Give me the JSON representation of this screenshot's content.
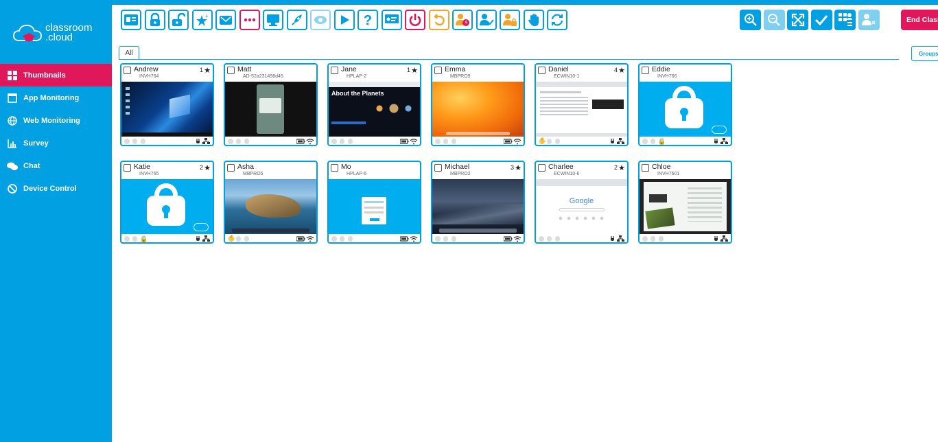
{
  "app": {
    "brand_line1": "classroom",
    "brand_line2": ".cloud"
  },
  "colors": {
    "primary": "#00a0e3",
    "accent": "#e0185b",
    "warn": "#f2a52e"
  },
  "sidebar": {
    "items": [
      {
        "label": "Thumbnails",
        "icon": "grid-icon",
        "active": true
      },
      {
        "label": "App Monitoring",
        "icon": "window-icon"
      },
      {
        "label": "Web Monitoring",
        "icon": "globe-icon"
      },
      {
        "label": "Survey",
        "icon": "bar-chart-icon"
      },
      {
        "label": "Chat",
        "icon": "chat-icon"
      },
      {
        "label": "Device Control",
        "icon": "ban-icon"
      }
    ]
  },
  "toolbar": {
    "buttons": [
      "id-card-icon",
      "lock-icon",
      "unlock-icon",
      "star-icon",
      "mail-icon",
      "more-icon",
      "monitor-icon",
      "rocket-icon",
      "eye-icon",
      "play-icon",
      "help-icon",
      "present-icon",
      "power-icon",
      "undo-icon",
      "user-time-icon",
      "user-check-icon",
      "user-lock-icon",
      "hand-icon",
      "refresh-icon"
    ]
  },
  "right_tools": {
    "buttons": [
      "zoom-in-icon",
      "zoom-out-icon",
      "expand-icon",
      "check-icon",
      "grid-user-icon",
      "user-x-icon"
    ],
    "end_class_label": "End Class",
    "groups_label": "Groups"
  },
  "tabs": {
    "all_label": "All"
  },
  "students": [
    {
      "name": "Andrew",
      "host": "INVH764",
      "stars": "1",
      "screen": "windows",
      "status": "plug"
    },
    {
      "name": "Matt",
      "host": "AD-52a231498d45",
      "stars": "",
      "screen": "android",
      "status": "battery"
    },
    {
      "name": "Jane",
      "host": "HPLAP-2",
      "stars": "1",
      "screen": "planets",
      "status": "battery"
    },
    {
      "name": "Emma",
      "host": "MBPRO9",
      "stars": "",
      "screen": "mac-orange",
      "status": "battery"
    },
    {
      "name": "Daniel",
      "host": "ECWIN10-1",
      "stars": "4",
      "screen": "browser",
      "status": "plug"
    },
    {
      "name": "Eddie",
      "host": "INVH766",
      "stars": "",
      "screen": "locked",
      "status": "plug"
    },
    {
      "name": "Katie",
      "host": "INVH765",
      "stars": "2",
      "screen": "locked",
      "status": "plug"
    },
    {
      "name": "Asha",
      "host": "MBPRO5",
      "stars": "",
      "screen": "mac-island",
      "status": "battery"
    },
    {
      "name": "Mo",
      "host": "HPLAP-6",
      "stars": "",
      "screen": "login",
      "status": "battery"
    },
    {
      "name": "Michael",
      "host": "MBPRO2",
      "stars": "3",
      "screen": "mac-dark",
      "status": "battery"
    },
    {
      "name": "Charlee",
      "host": "ECWIN10-6",
      "stars": "2",
      "screen": "google",
      "status": "plug"
    },
    {
      "name": "Chloe",
      "host": "INVH7601",
      "stars": "",
      "screen": "photo",
      "status": "plug"
    }
  ],
  "screens": {
    "planets_title": "About the Planets",
    "google_text": "Google"
  }
}
